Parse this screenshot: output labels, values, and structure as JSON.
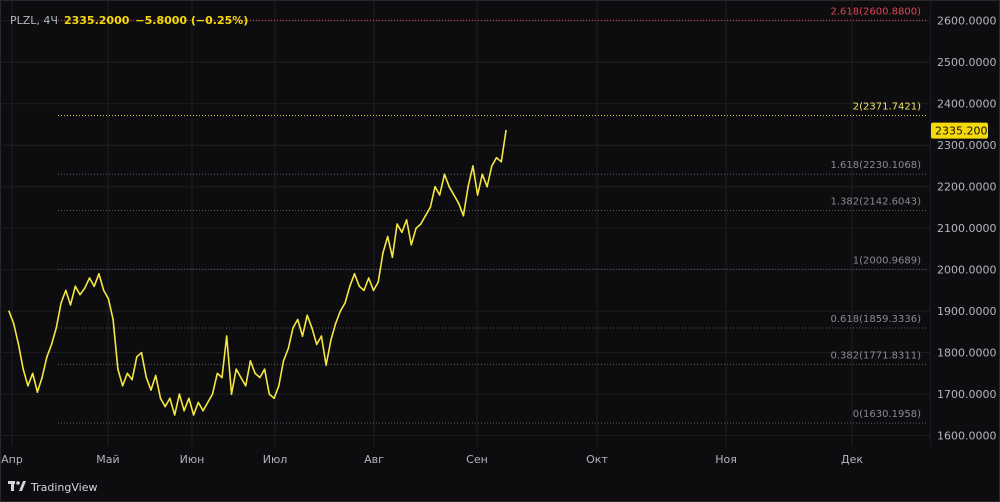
{
  "header": {
    "symbol": "PLZL, 4Ч",
    "price": "2335.2000",
    "change": "−5.8000 (−0.25%)"
  },
  "brand": {
    "name": "TradingView",
    "logo_icon": "tradingview-logo-icon"
  },
  "colors": {
    "background": "#0d0d0f",
    "line": "#f5e642",
    "grid": "#1e1e22",
    "text": "#b2b5be",
    "fib_line": "#5d5d62",
    "fib_2": "#d5c21b",
    "fib_2618": "#e04550",
    "price_badge": "#f5d90a"
  },
  "chart_data": {
    "type": "line",
    "title": "",
    "xlabel": "",
    "ylabel": "",
    "ylim": [
      1575,
      2650
    ],
    "x_ticks": [
      "Апр",
      "Май",
      "Июн",
      "Июл",
      "Авг",
      "Сен",
      "Окт",
      "Ноя",
      "Дек"
    ],
    "y_ticks": [
      "2600.0000",
      "2500.0000",
      "2400.0000",
      "2300.0000",
      "2200.0000",
      "2100.0000",
      "2000.0000",
      "1900.0000",
      "1800.0000",
      "1700.0000",
      "1600.0000"
    ],
    "y_tick_values": [
      2600,
      2500,
      2400,
      2300,
      2200,
      2100,
      2000,
      1900,
      1800,
      1700,
      1600
    ],
    "last_price": "2335.2000",
    "last_price_value": 2335.2,
    "fib_levels": [
      {
        "label": "2.618(2600.8800)",
        "value": 2600.88,
        "style": "red-dotted"
      },
      {
        "label": "2(2371.7421)",
        "value": 2371.7421,
        "style": "yellow-dotted"
      },
      {
        "label": "1.618(2230.1068)",
        "value": 2230.1068,
        "style": "gray-dotted"
      },
      {
        "label": "1.382(2142.6043)",
        "value": 2142.6043,
        "style": "gray-dotted"
      },
      {
        "label": "1(2000.9689)",
        "value": 2000.9689,
        "style": "gray-dotted"
      },
      {
        "label": "0.618(1859.3336)",
        "value": 1859.3336,
        "style": "gray-dotted"
      },
      {
        "label": "0.382(1771.8311)",
        "value": 1771.8311,
        "style": "gray-dotted"
      },
      {
        "label": "0(1630.1958)",
        "value": 1630.1958,
        "style": "gray-dotted"
      }
    ],
    "series": [
      {
        "x": [
          0,
          1,
          2,
          3,
          4,
          5,
          6,
          7,
          8,
          9,
          10,
          11,
          12,
          13,
          14,
          15,
          16,
          17,
          18,
          19,
          20,
          21,
          22,
          23,
          24,
          25,
          26,
          27,
          28,
          29,
          30,
          31,
          32,
          33,
          34,
          35,
          36,
          37,
          38,
          39,
          40,
          41,
          42,
          43,
          44,
          45,
          46,
          47,
          48,
          49,
          50,
          51,
          52,
          53,
          54,
          55,
          56,
          57,
          58,
          59,
          60,
          61,
          62,
          63,
          64,
          65,
          66,
          67,
          68,
          69,
          70,
          71,
          72,
          73,
          74,
          75,
          76,
          77,
          78,
          79,
          80,
          81,
          82,
          83,
          84,
          85,
          86,
          87,
          88,
          89,
          90,
          91,
          92,
          93,
          94,
          95,
          96,
          97,
          98,
          99,
          100,
          101,
          102,
          103,
          104,
          105
        ],
        "values": [
          1900,
          1870,
          1820,
          1760,
          1720,
          1750,
          1705,
          1740,
          1790,
          1820,
          1860,
          1920,
          1950,
          1915,
          1960,
          1940,
          1955,
          1980,
          1960,
          1990,
          1950,
          1930,
          1880,
          1760,
          1720,
          1750,
          1735,
          1790,
          1800,
          1740,
          1710,
          1745,
          1690,
          1670,
          1690,
          1650,
          1700,
          1660,
          1690,
          1650,
          1680,
          1660,
          1680,
          1700,
          1750,
          1740,
          1840,
          1700,
          1760,
          1740,
          1720,
          1780,
          1750,
          1740,
          1760,
          1700,
          1690,
          1720,
          1780,
          1810,
          1860,
          1880,
          1840,
          1890,
          1860,
          1820,
          1840,
          1770,
          1830,
          1870,
          1900,
          1920,
          1960,
          1990,
          1960,
          1950,
          1980,
          1950,
          1970,
          2040,
          2080,
          2030,
          2110,
          2090,
          2120,
          2060,
          2100,
          2110,
          2130,
          2150,
          2200,
          2180,
          2230,
          2200,
          2180,
          2160,
          2130,
          2200,
          2250,
          2180,
          2230,
          2200,
          2250,
          2270,
          2260,
          2335.2
        ]
      }
    ]
  }
}
